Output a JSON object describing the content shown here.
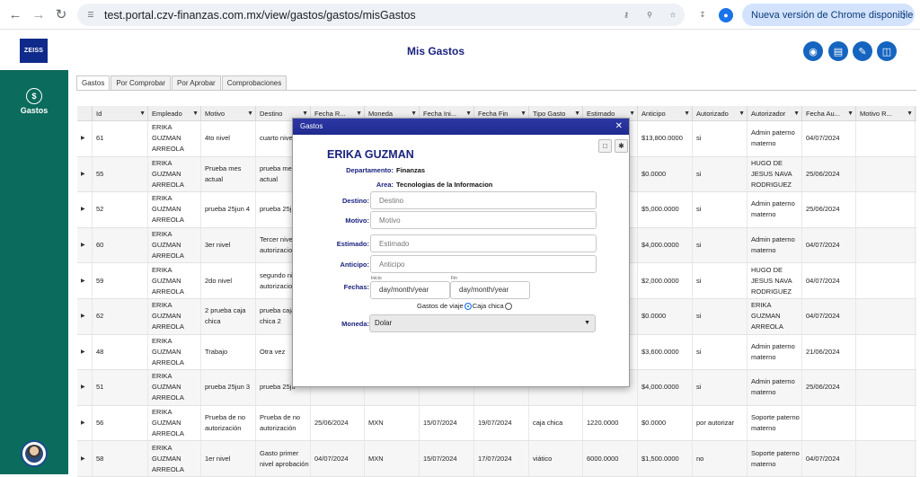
{
  "browser": {
    "url": "test.portal.czv-finanzas.com.mx/view/gastos/gastos/misGastos",
    "update_label": "Nueva versión de Chrome disponible"
  },
  "header": {
    "logo_text": "ZEISS",
    "title": "Mis Gastos"
  },
  "sidebar": {
    "items": [
      {
        "label": "Gastos",
        "icon": "money-icon"
      }
    ]
  },
  "tabs": [
    {
      "label": "Gastos",
      "active": true
    },
    {
      "label": "Por Comprobar",
      "active": false
    },
    {
      "label": "Por Aprobar",
      "active": false
    },
    {
      "label": "Comprobaciones",
      "active": false
    }
  ],
  "table": {
    "columns": [
      "",
      "Id",
      "Empleado",
      "Motivo",
      "Destino",
      "Fecha R...",
      "Moneda",
      "Fecha Ini...",
      "Fecha Fin",
      "Tipo Gasto",
      "Estimado",
      "Anticipo",
      "Autorizado",
      "Autorizador",
      "Fecha Au...",
      "Motivo R..."
    ],
    "rows": [
      [
        "▶",
        "61",
        "ERIKA\nGUZMAN\nARREOLA",
        "4to nivel",
        "cuarto nivel",
        "",
        "",
        "",
        "",
        "",
        "",
        "$13,800.0000",
        "si",
        "Admin paterno\nmaterno",
        "04/07/2024",
        ""
      ],
      [
        "▶",
        "55",
        "ERIKA\nGUZMAN\nARREOLA",
        "Prueba mes\nactual",
        "prueba mes\nactual",
        "",
        "",
        "",
        "",
        "",
        "",
        "$0.0000",
        "si",
        "HUGO DE\nJESUS NAVA\nRODRIGUEZ",
        "25/06/2024",
        ""
      ],
      [
        "▶",
        "52",
        "ERIKA\nGUZMAN\nARREOLA",
        "prueba 25jun 4",
        "prueba 25ju",
        "",
        "",
        "",
        "",
        "",
        "",
        "$5,000.0000",
        "si",
        "Admin paterno\nmaterno",
        "25/06/2024",
        ""
      ],
      [
        "▶",
        "60",
        "ERIKA\nGUZMAN\nARREOLA",
        "3er nivel",
        "Tercer nivel\nautorizacion",
        "",
        "",
        "",
        "",
        "",
        "",
        "$4,000.0000",
        "si",
        "Admin paterno\nmaterno",
        "04/07/2024",
        ""
      ],
      [
        "▶",
        "59",
        "ERIKA\nGUZMAN\nARREOLA",
        "2do nivel",
        "segundo ni\nautorizacio",
        "",
        "",
        "",
        "",
        "",
        "",
        "$2,000.0000",
        "si",
        "HUGO DE\nJESUS NAVA\nRODRIGUEZ",
        "04/07/2024",
        ""
      ],
      [
        "▶",
        "62",
        "ERIKA\nGUZMAN\nARREOLA",
        "2 prueba caja\nchica",
        "prueba caja\nchica 2",
        "",
        "",
        "",
        "",
        "",
        "",
        "$0.0000",
        "si",
        "ERIKA\nGUZMAN\nARREOLA",
        "04/07/2024",
        ""
      ],
      [
        "▶",
        "48",
        "ERIKA\nGUZMAN\nARREOLA",
        "Trabajo",
        "Otra vez",
        "",
        "",
        "",
        "",
        "",
        "",
        "$3,600.0000",
        "si",
        "Admin paterno\nmaterno",
        "21/06/2024",
        ""
      ],
      [
        "▶",
        "51",
        "ERIKA\nGUZMAN\nARREOLA",
        "prueba 25jun 3",
        "prueba 25ju",
        "",
        "",
        "",
        "",
        "",
        "",
        "$4,000.0000",
        "si",
        "Admin paterno\nmaterno",
        "25/06/2024",
        ""
      ],
      [
        "▶",
        "56",
        "ERIKA\nGUZMAN\nARREOLA",
        "Prueba de no\nautorización",
        "Prueba de no\nautorización",
        "25/06/2024",
        "MXN",
        "15/07/2024",
        "19/07/2024",
        "caja chica",
        "1220.0000",
        "$0.0000",
        "por autorizar",
        "Soporte paterno\nmaterno",
        "",
        ""
      ],
      [
        "▶",
        "58",
        "ERIKA\nGUZMAN\nARREOLA",
        "1er nivel",
        "Gasto primer\nnivel aprobación",
        "04/07/2024",
        "MXN",
        "15/07/2024",
        "17/07/2024",
        "viático",
        "6000.0000",
        "$1,500.0000",
        "no",
        "Soporte paterno\nmaterno",
        "04/07/2024",
        ""
      ]
    ]
  },
  "modal": {
    "title": "Gastos",
    "employee_name": "ERIKA GUZMAN",
    "department_label": "Departamento:",
    "department_value": "Finanzas",
    "area_label": "Area:",
    "area_value": "Tecnologias de la Informacion",
    "destino_label": "Destino:",
    "destino_placeholder": "Destino",
    "motivo_label": "Motivo:",
    "motivo_placeholder": "Motivo",
    "estimado_label": "Estimado:",
    "estimado_placeholder": "Estimado",
    "anticipo_label": "Anticipo:",
    "anticipo_placeholder": "Anticipo",
    "fechas_label": "Fechas:",
    "inicio_label": "Inicio",
    "fin_label": "Fin",
    "inicio_value": "day/month/year",
    "fin_value": "day/month/year",
    "radio_viaje": "Gastos de viaje",
    "radio_caja": "Caja chica",
    "moneda_label": "Moneda:",
    "moneda_value": "Dolar"
  }
}
